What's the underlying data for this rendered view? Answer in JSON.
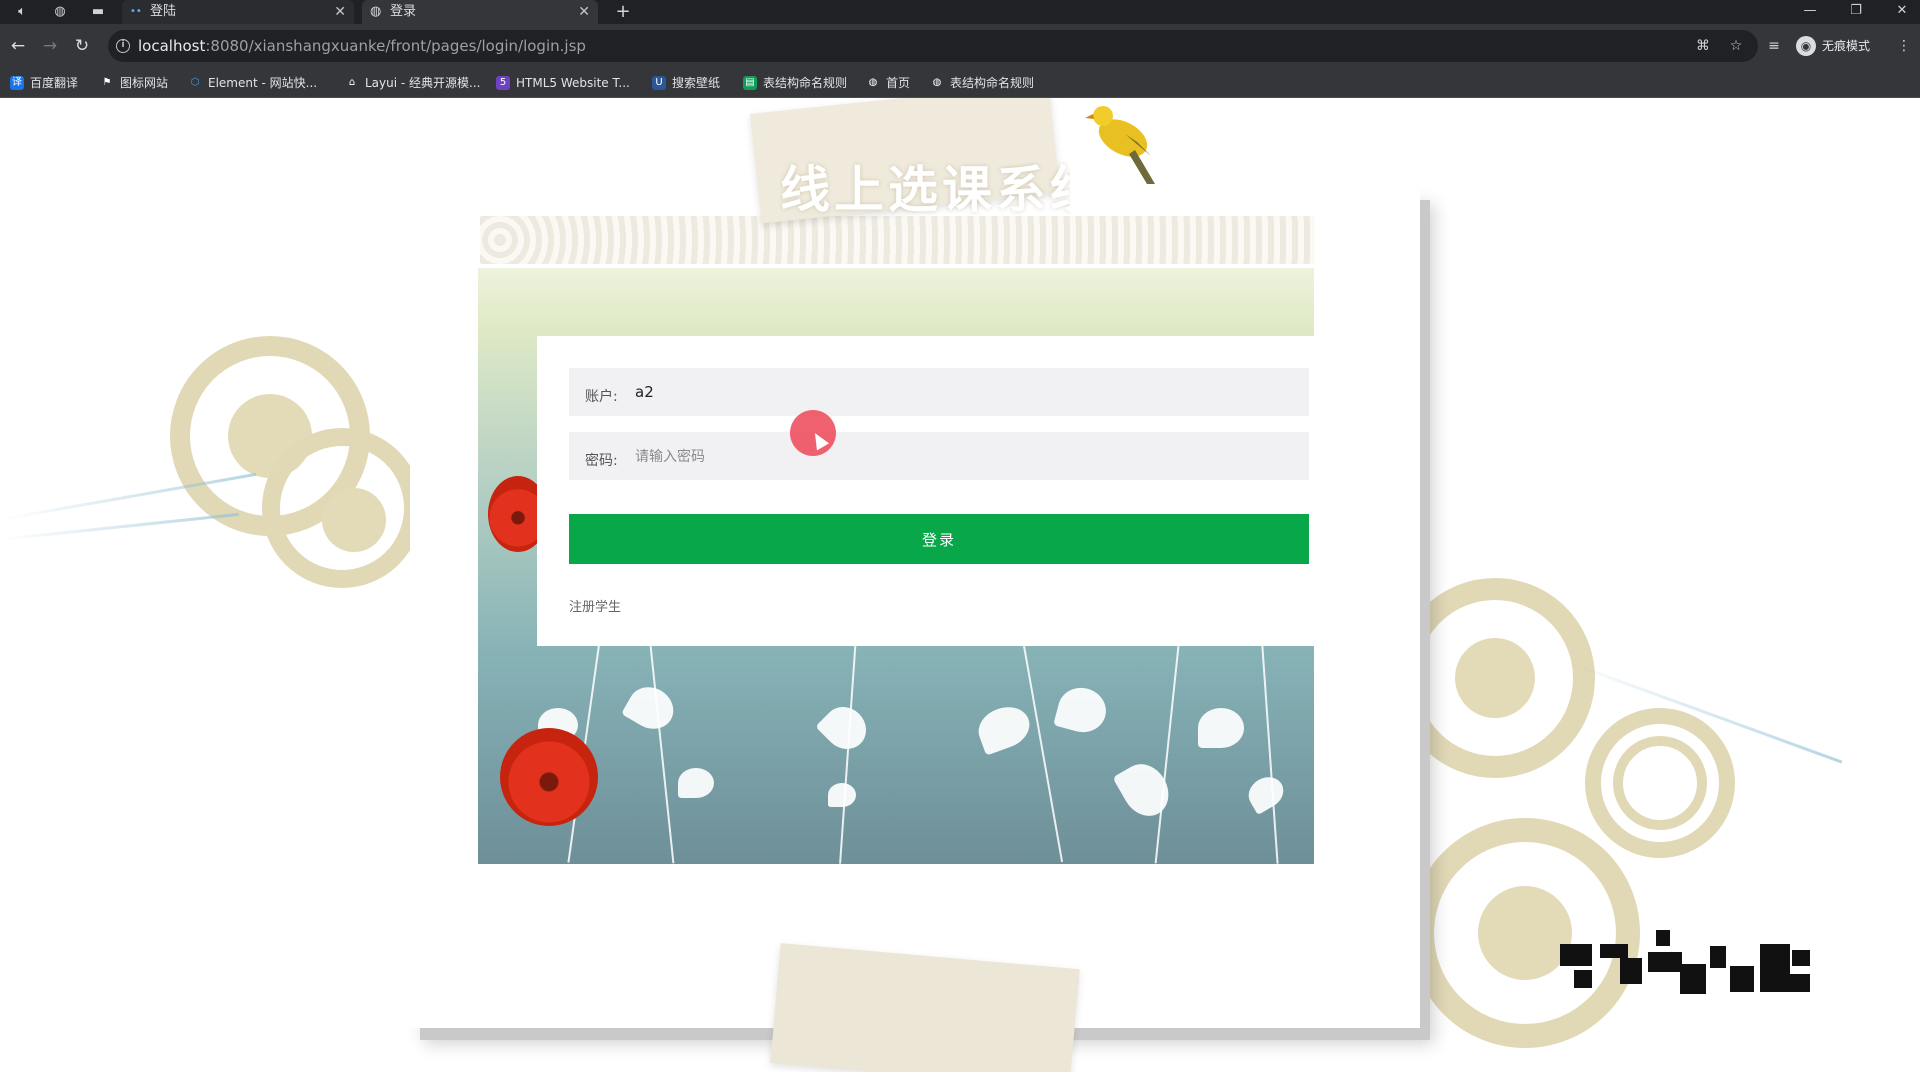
{
  "browser": {
    "tabs": [
      {
        "label": "登陆",
        "active": false
      },
      {
        "label": "登录",
        "active": true
      }
    ],
    "new_tab": "+",
    "address": {
      "host": "localhost",
      "path": ":8080/xianshangxuanke/front/pages/login/login.jsp"
    },
    "profile_label": "无痕模式",
    "bookmarks": [
      {
        "label": "百度翻译",
        "icon": "translate-icon",
        "color": "#1a73e8"
      },
      {
        "label": "图标网站",
        "icon": "flag-icon",
        "color": "#35363a"
      },
      {
        "label": "Element - 网站快...",
        "icon": "element-icon",
        "color": "#409eff"
      },
      {
        "label": "Layui - 经典开源模...",
        "icon": "layui-icon",
        "color": "#35363a"
      },
      {
        "label": "HTML5 Website T...",
        "icon": "html5-icon",
        "color": "#6f42c1"
      },
      {
        "label": "搜索壁纸",
        "icon": "wallpaper-icon",
        "color": "#2b5797"
      },
      {
        "label": "表结构命名规则",
        "icon": "sheet-icon",
        "color": "#0f9d58"
      },
      {
        "label": "首页",
        "icon": "globe-icon",
        "color": "#35363a"
      },
      {
        "label": "表结构命名规则",
        "icon": "globe-icon",
        "color": "#35363a"
      }
    ]
  },
  "page": {
    "site_title": "线上选课系统",
    "login": {
      "account_label": "账户:",
      "account_value": "a2",
      "password_label": "密码:",
      "password_placeholder": "请输入密码",
      "submit_label": "登录",
      "register_link": "注册学生"
    }
  },
  "colors": {
    "accent_green": "#08a84a",
    "chrome_dark": "#35363a",
    "decor_beige": "#e1d8b6"
  }
}
